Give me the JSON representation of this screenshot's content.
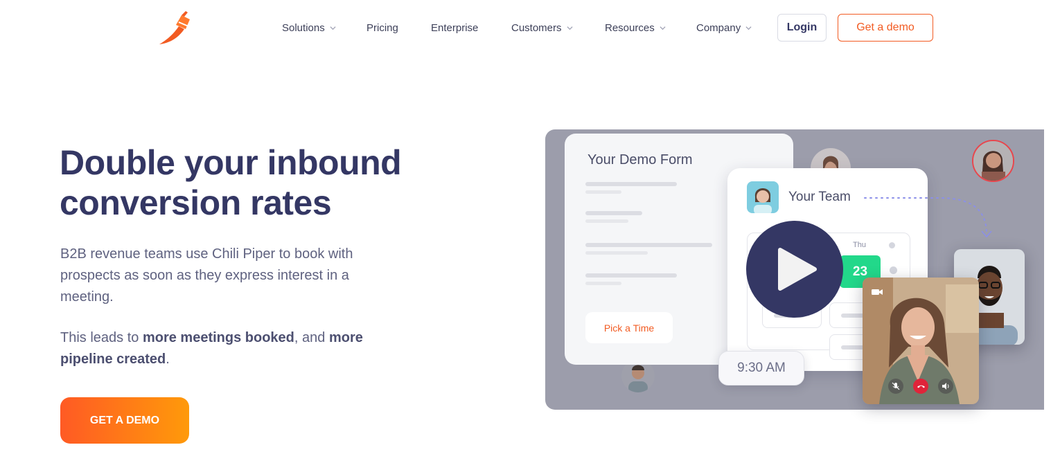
{
  "nav": {
    "items": [
      {
        "label": "Solutions",
        "has_dropdown": true
      },
      {
        "label": "Pricing",
        "has_dropdown": false
      },
      {
        "label": "Enterprise",
        "has_dropdown": false
      },
      {
        "label": "Customers",
        "has_dropdown": true
      },
      {
        "label": "Resources",
        "has_dropdown": true
      },
      {
        "label": "Company",
        "has_dropdown": true
      }
    ],
    "login_label": "Login",
    "demo_label": "Get a demo"
  },
  "hero": {
    "title": "Double your inbound conversion rates",
    "paragraph1": "B2B revenue teams use Chili Piper to book with prospects as soon as they express interest in a meeting.",
    "paragraph2": {
      "part1": "This leads to ",
      "bold1": "more meetings booked",
      "part2": ", and ",
      "bold2": "more pipeline created",
      "part3": "."
    },
    "cta_label": "GET A DEMO"
  },
  "illustration": {
    "form_title": "Your Demo Form",
    "pick_time_label": "Pick a Time",
    "team_title": "Your Team",
    "day_label": "Thu",
    "day_number": "23",
    "time_label": "9:30 AM"
  },
  "colors": {
    "brand_orange": "#f25b22",
    "navy": "#343764",
    "green": "#22d88a",
    "panel_gray": "#9c9dab"
  },
  "icons": [
    "chili-logo-icon",
    "chevron-down-icon",
    "play-icon",
    "camera-icon",
    "mute-icon",
    "hangup-icon",
    "speaker-icon"
  ]
}
